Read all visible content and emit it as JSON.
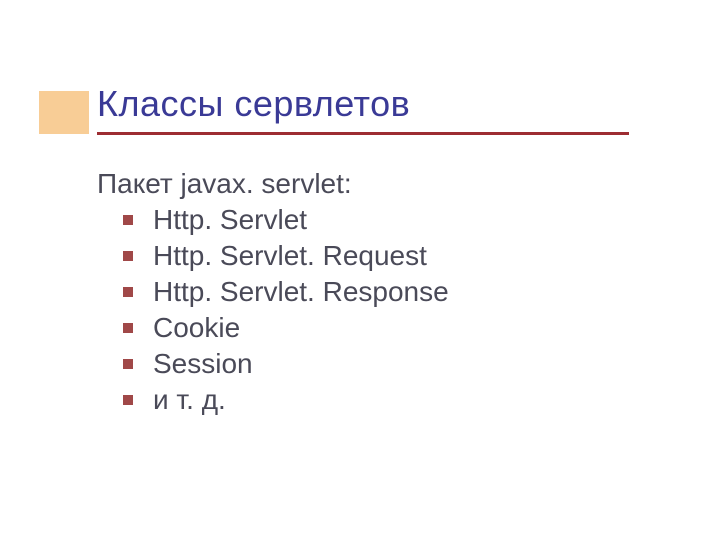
{
  "colors": {
    "title": "#3a3a96",
    "underline": "#9d2d32",
    "accent_block": "#f2a440",
    "bullet": "#a04848",
    "text": "#4a4a58"
  },
  "title": "Классы сервлетов",
  "intro": "Пакет javax. servlet:",
  "items": [
    "Http. Servlet",
    "Http. Servlet. Request",
    "Http. Servlet. Response",
    "Cookie",
    "Session",
    "и т. д."
  ]
}
